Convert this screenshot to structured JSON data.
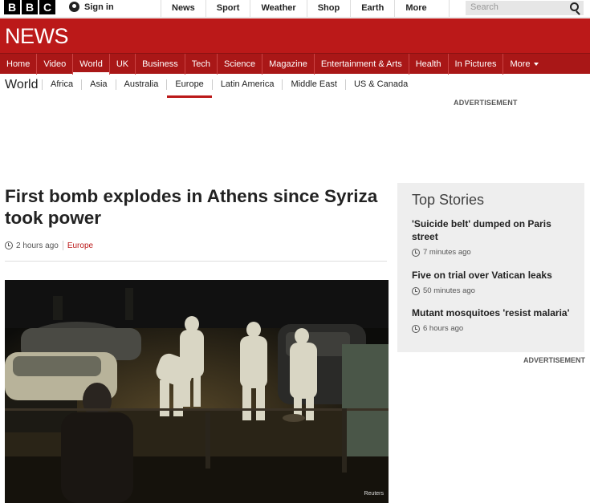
{
  "logo": [
    "B",
    "B",
    "C"
  ],
  "account": {
    "signin": "Sign in"
  },
  "topnav": [
    "News",
    "Sport",
    "Weather",
    "Shop",
    "Earth",
    "More"
  ],
  "search": {
    "placeholder": "Search"
  },
  "brand": "NEWS",
  "sections": [
    "Home",
    "Video",
    "World",
    "UK",
    "Business",
    "Tech",
    "Science",
    "Magazine",
    "Entertainment & Arts",
    "Health",
    "In Pictures",
    "More"
  ],
  "active_section": "World",
  "subnav": {
    "title": "World",
    "regions": [
      "Africa",
      "Asia",
      "Australia",
      "Europe",
      "Latin America",
      "Middle East",
      "US & Canada"
    ],
    "active": "Europe"
  },
  "ads": {
    "top": "ADVERTISEMENT",
    "side": "ADVERTISEMENT"
  },
  "article": {
    "headline": "First bomb explodes in Athens since Syriza took power",
    "time": "2 hours ago",
    "section": "Europe",
    "photo_credit": "Reuters"
  },
  "top_stories": {
    "title": "Top Stories",
    "items": [
      {
        "headline": "'Suicide belt' dumped on Paris street",
        "time": "7 minutes ago"
      },
      {
        "headline": "Five on trial over Vatican leaks",
        "time": "50 minutes ago"
      },
      {
        "headline": "Mutant mosquitoes 'resist malaria'",
        "time": "6 hours ago"
      }
    ]
  },
  "colors": {
    "brand_red": "#bb1919",
    "nav_red": "#a91717"
  }
}
